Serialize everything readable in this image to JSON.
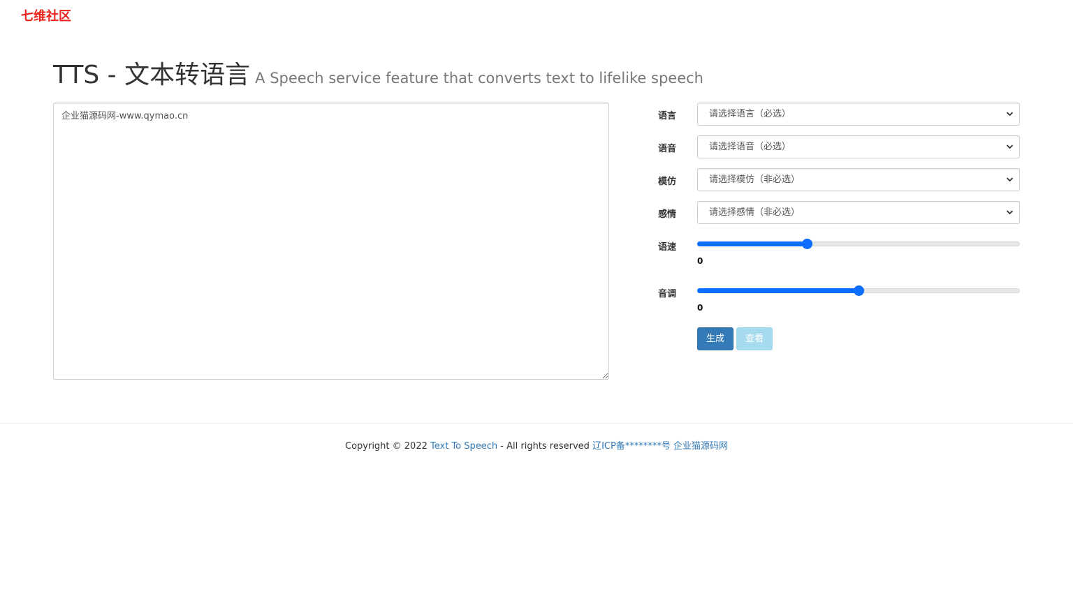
{
  "logo": "七维社区",
  "header": {
    "title": "TTS - 文本转语言",
    "subtitle": "A Speech service feature that converts text to lifelike speech"
  },
  "textarea": {
    "value": "企业猫源码网-www.qymao.cn"
  },
  "form": {
    "language": {
      "label": "语言",
      "selected": "请选择语言（必选）"
    },
    "voice": {
      "label": "语音",
      "selected": "请选择语音（必选）"
    },
    "mimic": {
      "label": "模仿",
      "selected": "请选择模仿（非必选）"
    },
    "emotion": {
      "label": "感情",
      "selected": "请选择感情（非必选）"
    },
    "speed": {
      "label": "语速",
      "value": "0",
      "level": 0.34
    },
    "pitch": {
      "label": "音调",
      "value": "0",
      "level": 0.5
    },
    "generate_label": "生成",
    "view_label": "查看"
  },
  "footer": {
    "prefix": "Copyright © 2022 ",
    "link1": "Text To Speech",
    "middle": " - All rights reserved ",
    "link2": "辽ICP备********号",
    "link3": "企业猫源码网"
  },
  "colors": {
    "accent": "#337ab7",
    "slider": "#0d6efd",
    "logo": "#e8241c",
    "view_button_disabled": "#a6dbef"
  },
  "icons": {
    "select_chevron": "chevron-down-icon"
  }
}
